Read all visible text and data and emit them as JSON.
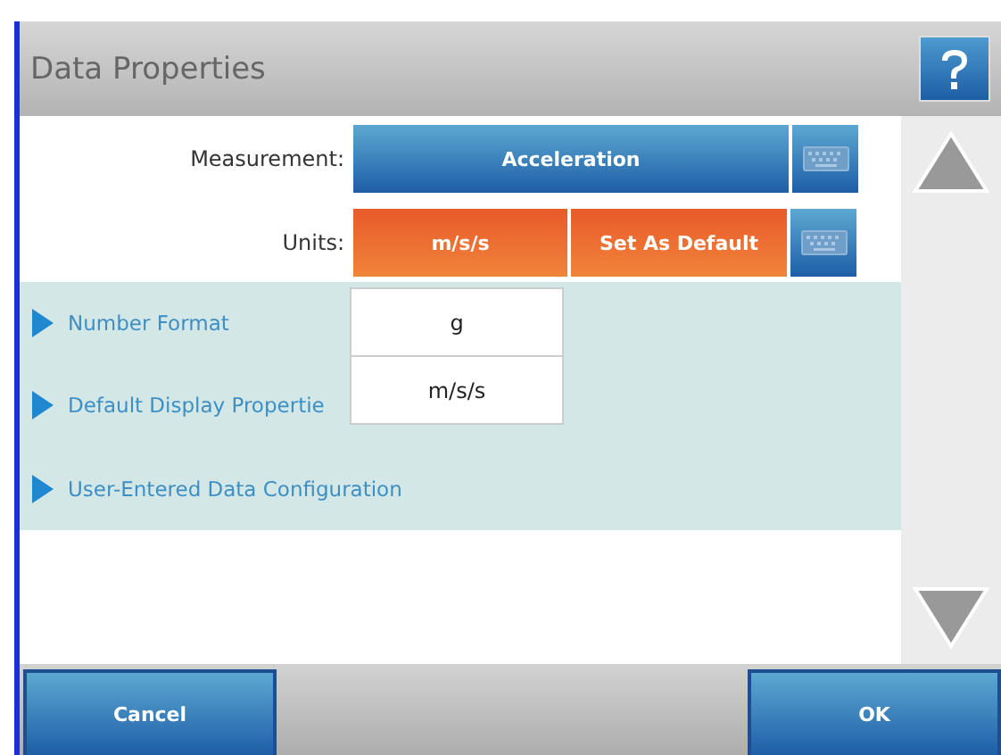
{
  "window": {
    "title": "Data Properties"
  },
  "fields": [
    {
      "label": "Measurement:",
      "value": "Acceleration",
      "kind": "select"
    },
    {
      "label": "Units:",
      "value": "m/s/s",
      "kind": "units",
      "action": "Set As Default"
    }
  ],
  "dropdown": {
    "options": [
      "g",
      "m/s/s"
    ]
  },
  "sections": [
    {
      "label": "Number Format",
      "expanded": false
    },
    {
      "label": "Default Display Propertie",
      "expanded": false
    },
    {
      "label": "User-Entered Data Configuration",
      "expanded": false
    }
  ],
  "buttons": [
    {
      "label": "Cancel"
    },
    {
      "label": "OK"
    }
  ]
}
